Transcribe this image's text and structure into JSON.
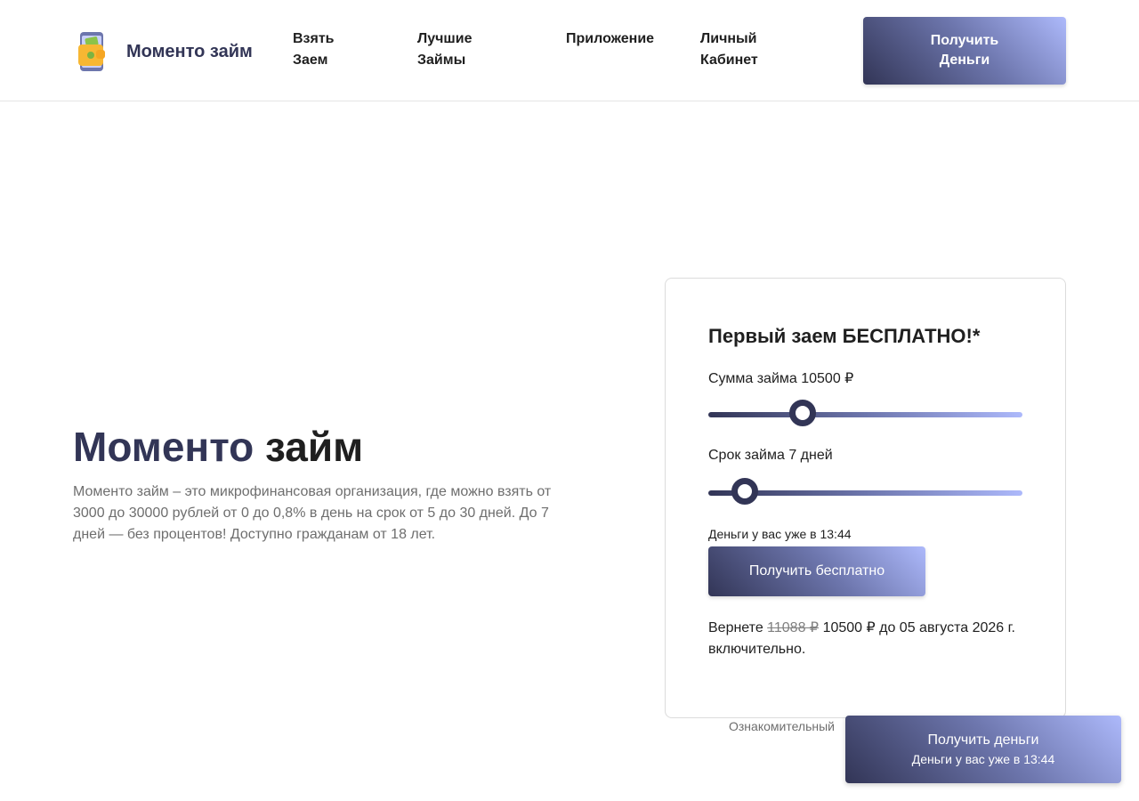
{
  "header": {
    "logo_text": "Моменто займ",
    "logo_icon": "wallet-phone-icon",
    "nav": [
      {
        "label": "Взять Заем"
      },
      {
        "label": "Лучшие Займы"
      },
      {
        "label": "Приложение"
      },
      {
        "label": "Личный Кабинет"
      }
    ],
    "cta_label": "Получить Деньги"
  },
  "hero": {
    "title_part1": "Моменто",
    "title_part2": "займ",
    "description": "Моменто займ – это микрофинансовая организация, где можно взять от 3000 до 30000 рублей от 0 до 0,8% в день на срок от 5 до 30 дней. До 7 дней — без процентов! Доступно гражданам от 18 лет."
  },
  "card": {
    "title": "Первый заем БЕСПЛАТНО!*",
    "amount_label": "Сумма займа 10500 ₽",
    "amount_fraction": 0.3,
    "term_label": "Срок займа 7 дней",
    "term_fraction": 0.117,
    "arrival_text": "Деньги у вас уже в 13:44",
    "cta_label": "Получить бесплатно",
    "repay_prefix": "Вернете",
    "repay_old": "11088 ₽",
    "repay_rest": "10500 ₽ до 05 августа 2026 г. включительно."
  },
  "disclaimer": "Ознакомительный",
  "floating_cta": {
    "main": "Получить деньги",
    "sub": "Деньги у вас уже в 13:44"
  },
  "colors": {
    "brand_dark": "#323556",
    "brand_light": "#adb9fb"
  }
}
